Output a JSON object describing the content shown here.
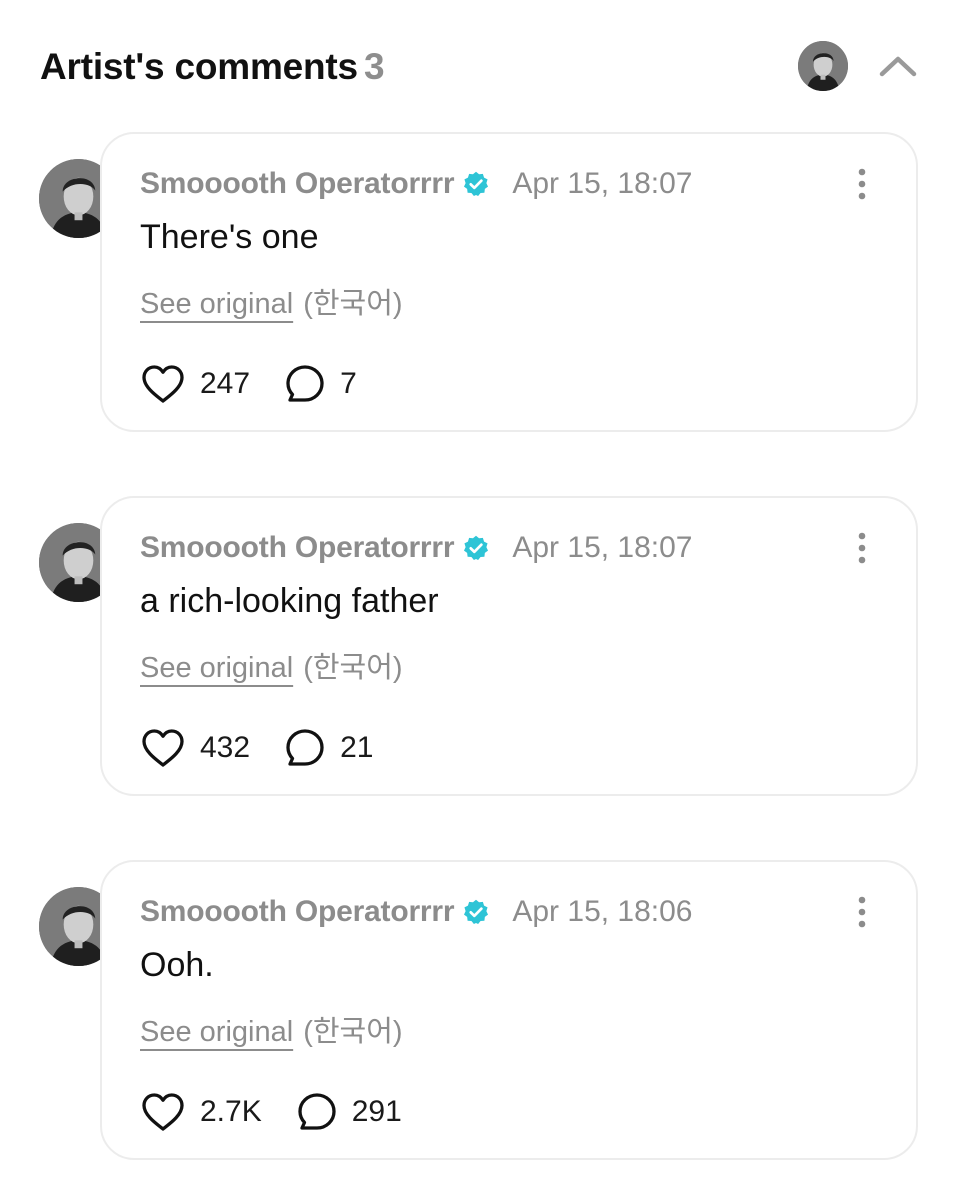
{
  "header": {
    "title": "Artist's comments",
    "count": "3"
  },
  "colors": {
    "verified_badge": "#2ec4d6",
    "muted_text": "#8c8c8c",
    "card_border": "#ececec"
  },
  "comments": [
    {
      "author": "Smooooth Operatorrrr",
      "timestamp": "Apr 15, 18:07",
      "text": "There's one",
      "see_original_label": "See original",
      "language": "(한국어)",
      "likes": "247",
      "replies": "7"
    },
    {
      "author": "Smooooth Operatorrrr",
      "timestamp": "Apr 15, 18:07",
      "text": "a rich-looking father",
      "see_original_label": "See original",
      "language": "(한국어)",
      "likes": "432",
      "replies": "21"
    },
    {
      "author": "Smooooth Operatorrrr",
      "timestamp": "Apr 15, 18:06",
      "text": "Ooh.",
      "see_original_label": "See original",
      "language": "(한국어)",
      "likes": "2.7K",
      "replies": "291"
    }
  ]
}
